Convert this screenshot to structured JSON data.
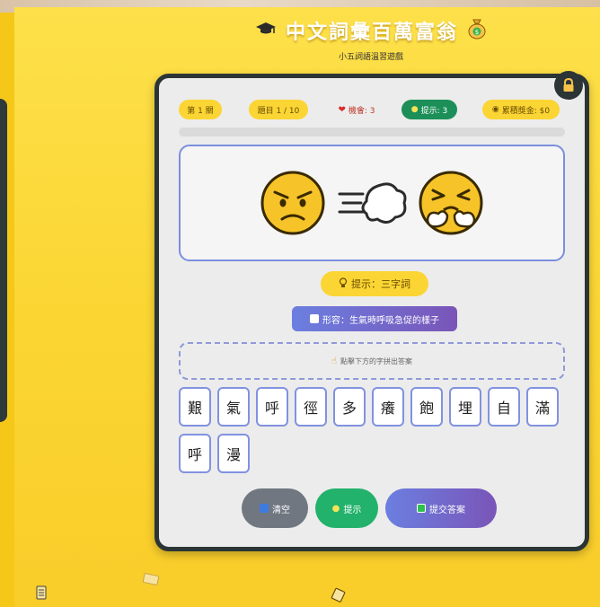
{
  "header": {
    "title": "中文詞彙百萬富翁",
    "subtitle": "小五詞語溫習遊戲",
    "icons": [
      "graduation-cap-icon",
      "money-bag-icon"
    ]
  },
  "status": {
    "level": "第 1 關",
    "question": "題目 1 / 10",
    "lives": "機會: 3",
    "hints": "提示: 3",
    "prize": "累積獎金: $0"
  },
  "progress_fraction": 0,
  "clue": {
    "emojis": [
      "angry-face-icon",
      "dash-icon",
      "steam-nose-face-icon"
    ],
    "hint": "提示：三字詞",
    "description": "形容：生氣時呼吸急促的樣子"
  },
  "answer_zone": {
    "placeholder": "點擊下方的字拼出答案"
  },
  "tiles": [
    "艱",
    "氣",
    "呼",
    "徑",
    "多",
    "癢",
    "飽",
    "埋",
    "自",
    "滿",
    "呼",
    "漫"
  ],
  "buttons": {
    "clear": "清空",
    "hint": "提示",
    "submit": "提交答案"
  },
  "colors": {
    "background": "#fbd633",
    "card_border": "#2b3536",
    "accent_purple": "#6b7fe0",
    "hint_yellow": "#fbd534",
    "green": "#1c8f58"
  }
}
